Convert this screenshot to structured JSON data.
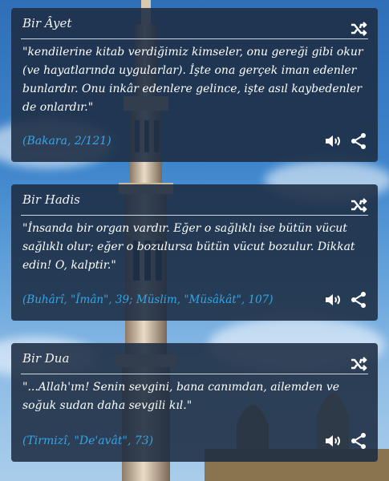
{
  "cards": [
    {
      "title": "Bir Âyet",
      "text": "\"kendilerine kitab verdiğimiz kimseler, onu gereği gibi okur (ve hayatlarında uygularlar). İşte ona gerçek iman edenler bunlardır. Onu inkâr edenlere gelince, işte asıl kaybedenler de onlardır.\"",
      "source": "(Bakara, 2/121)",
      "icons": [
        "shuffle-icon",
        "speaker-icon",
        "share-icon"
      ]
    },
    {
      "title": "Bir Hadis",
      "text": "\"İnsanda bir organ vardır. Eğer o sağlıklı ise bütün vücut sağlıklı olur; eğer o bozulursa bütün vücut bozulur. Dikkat edin! O, kalptir.\"",
      "source": "(Buhârî, \"Îmân\", 39; Müslim, \"Müsâkât\", 107)",
      "icons": [
        "shuffle-icon",
        "speaker-icon",
        "share-icon"
      ]
    },
    {
      "title": "Bir Dua",
      "text": "\"...Allah'ım! Senin sevgini, bana canımdan, ailemden ve soğuk sudan daha sevgili kıl.\"",
      "source": "(Tirmizî, \"De'avât\", 73)",
      "icons": [
        "shuffle-icon",
        "speaker-icon",
        "share-icon"
      ]
    }
  ],
  "colors": {
    "card_bg": "#1c2c42",
    "source_text": "#35a6e8",
    "text": "#ffffff"
  }
}
